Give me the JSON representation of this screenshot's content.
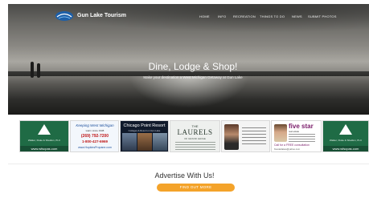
{
  "header": {
    "site_name": "Gun Lake Tourism",
    "nav": [
      "HOME",
      "INFO",
      "RECREATION",
      "THINGS TO DO",
      "NEWS",
      "SUBMIT PHOTOS"
    ]
  },
  "hero": {
    "headline": "Dine, Lodge & Shop!",
    "subline": "Make your destination a West Michigan Getaway at Gun Lake"
  },
  "ads": {
    "ad1": {
      "firm": "Walker, Fluke & Sheldon, PLC",
      "url": "www.wfscpas.com"
    },
    "ad2": {
      "line1": "Keeping West Michigan",
      "line2": "warm since 1938",
      "phone1": "(269) 792-7200",
      "phone2": "1-800-427-6969",
      "url": "www.HopkinsPropane.com"
    },
    "ad3": {
      "title": "Chicago Point Resort",
      "sub": "Cottages & Resort on Gun Lake"
    },
    "ad4": {
      "pre": "THE",
      "title": "LAURELS",
      "sub": "OF GRAND LEDGE"
    },
    "ad6": {
      "brand": "five star",
      "sub": "real estate",
      "call": "Call for a FREE consultation",
      "email": "fivestarlakes@yahoo.com"
    },
    "ad7": {
      "firm": "Walker, Fluke & Sheldon, PLC",
      "url": "www.wfscpas.com"
    }
  },
  "advertise": {
    "title": "Advertise With Us!",
    "button": "FIND OUT MORE"
  },
  "colors": {
    "accent": "#f4a32a",
    "ad_green": "#1f6b45"
  }
}
